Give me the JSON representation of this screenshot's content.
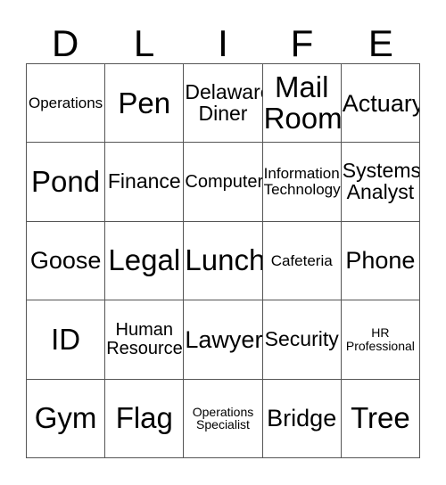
{
  "card": {
    "title_letters": [
      "D",
      "L",
      "I",
      "F",
      "E"
    ],
    "grid_size": "5x5",
    "free_space": false,
    "border_color": "#555555",
    "text_color": "#000000",
    "background_color": "#ffffff",
    "rows": [
      [
        {
          "label": "Operations",
          "size": "s-xs"
        },
        {
          "label": "Pen",
          "size": "s-xl"
        },
        {
          "label": "Delaware\nDiner",
          "size": "s-md"
        },
        {
          "label": "Mail\nRoom",
          "size": "s-xl"
        },
        {
          "label": "Actuary",
          "size": "s-lg"
        }
      ],
      [
        {
          "label": "Pond",
          "size": "s-xl"
        },
        {
          "label": "Finance",
          "size": "s-md"
        },
        {
          "label": "Computer",
          "size": "s-sm"
        },
        {
          "label": "Information\nTechnology",
          "size": "s-xs"
        },
        {
          "label": "Systems\nAnalyst",
          "size": "s-md"
        }
      ],
      [
        {
          "label": "Goose",
          "size": "s-lg"
        },
        {
          "label": "Legal",
          "size": "s-xl"
        },
        {
          "label": "Lunch",
          "size": "s-xl"
        },
        {
          "label": "Cafeteria",
          "size": "s-xs"
        },
        {
          "label": "Phone",
          "size": "s-lg"
        }
      ],
      [
        {
          "label": "ID",
          "size": "s-xl"
        },
        {
          "label": "Human\nResources",
          "size": "s-sm"
        },
        {
          "label": "Lawyer",
          "size": "s-lg"
        },
        {
          "label": "Security",
          "size": "s-md"
        },
        {
          "label": "HR\nProfessional",
          "size": "s-xxs"
        }
      ],
      [
        {
          "label": "Gym",
          "size": "s-xl"
        },
        {
          "label": "Flag",
          "size": "s-xl"
        },
        {
          "label": "Operations\nSpecialist",
          "size": "s-xxs"
        },
        {
          "label": "Bridge",
          "size": "s-lg"
        },
        {
          "label": "Tree",
          "size": "s-xl"
        }
      ]
    ]
  }
}
